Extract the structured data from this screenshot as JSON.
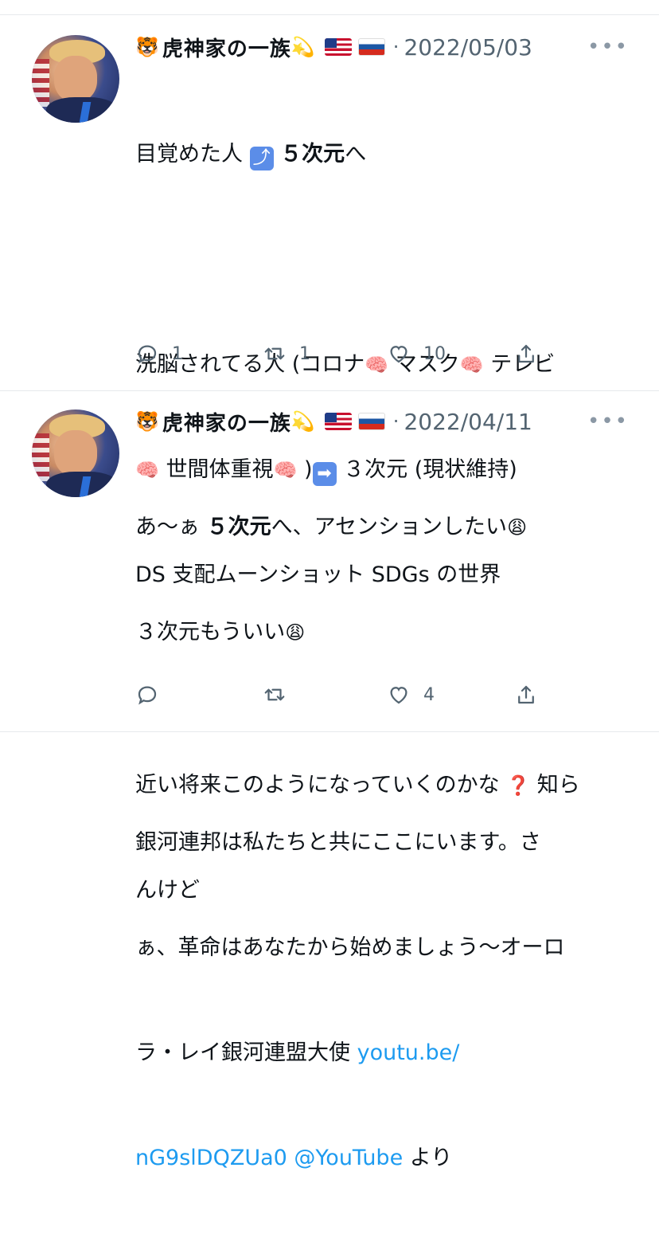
{
  "tweets": [
    {
      "display_name": "虎神家の一族",
      "name_emoji_prefix": "🐯",
      "name_emoji_suffix": "💫",
      "separator": "·",
      "date": "2022/05/03",
      "more_label": "•••",
      "body": {
        "line1_text": "目覚めた人",
        "line1_emoji": "⤴",
        "line1_bold": "５次元",
        "line1_after": "へ",
        "line2": "洗脳されてる人 (コロナ",
        "brain": "🧠",
        "line2_b": "マスク",
        "line2_c": "テレビ",
        "line3_a": "世間体重視",
        "line3_b": ")",
        "arrow": "➡",
        "line3_c": "３次元 (現状維持)",
        "line4": "DS 支配ムーンショット SDGs の世界",
        "line5_a": "近い将来このようになっていくのかな",
        "question": "❓",
        "line5_b": "知ら",
        "line6": "んけど"
      },
      "counts": {
        "reply": "1",
        "retweet": "1",
        "like": "10"
      }
    },
    {
      "display_name": "虎神家の一族",
      "name_emoji_prefix": "🐯",
      "name_emoji_suffix": "💫",
      "separator": "·",
      "date": "2022/04/11",
      "more_label": "•••",
      "body": {
        "line1_a": "あ〜ぁ",
        "line1_bold": "５次元",
        "line1_b": "へ、アセンションしたい",
        "tired": "😩",
        "line2": "３次元もういい",
        "line3": "銀河連邦は私たちと共にここにいます。さ",
        "line4": "ぁ、革命はあなたから始めましょう〜オーロ",
        "line5_a": "ラ・レイ銀河連盟大使",
        "link1": "youtu.be/",
        "link2": "nG9slDQZUa0 @YouTube",
        "line6_b": "より"
      },
      "counts": {
        "reply": "",
        "retweet": "",
        "like": "4"
      }
    }
  ]
}
